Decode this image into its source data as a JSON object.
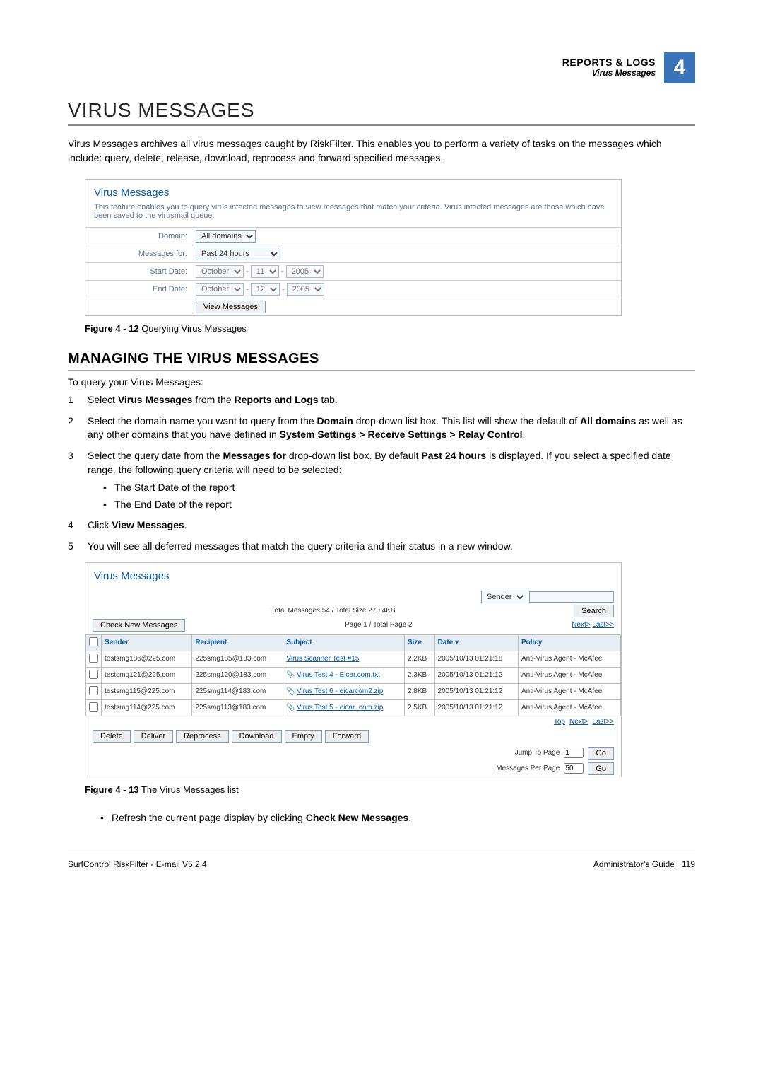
{
  "header": {
    "section": "REPORTS & LOGS",
    "subsection": "Virus Messages",
    "chapter_num": "4"
  },
  "title": "VIRUS MESSAGES",
  "lead": "Virus Messages archives all virus messages caught by RiskFilter. This enables you to perform a variety of tasks on the messages which include: query, delete, release, download, reprocess and forward specified messages.",
  "panel1": {
    "title": "Virus Messages",
    "desc": "This feature enables you to query virus infected messages to view messages that match your criteria. Virus infected messages are those which have been saved to the virusmail queue.",
    "rows": {
      "domain_label": "Domain:",
      "domain_value": "All domains",
      "messagesfor_label": "Messages for:",
      "messagesfor_value": "Past 24 hours",
      "startdate_label": "Start Date:",
      "startdate_month": "October",
      "startdate_day": "11",
      "startdate_year": "2005",
      "enddate_label": "End Date:",
      "enddate_month": "October",
      "enddate_day": "12",
      "enddate_year": "2005",
      "view_btn": "View Messages"
    }
  },
  "figcap1_label": "Figure 4 - 12",
  "figcap1_text": " Querying Virus Messages",
  "sub": "MANAGING THE VIRUS MESSAGES",
  "intro": "To query your Virus Messages:",
  "steps": {
    "s1_a": "Select ",
    "s1_b": "Virus Messages",
    "s1_c": " from the ",
    "s1_d": "Reports and Logs",
    "s1_e": " tab.",
    "s2_a": "Select the domain name you want to query from the ",
    "s2_b": "Domain",
    "s2_c": " drop-down list box. This list will show the default of ",
    "s2_d": "All domains",
    "s2_e": " as well as any other domains that you have defined in ",
    "s2_f": "System Settings > Receive Settings > Relay Control",
    "s2_g": ".",
    "s3_a": "Select the query date from the ",
    "s3_b": "Messages for",
    "s3_c": " drop-down list box. By default ",
    "s3_d": "Past 24 hours",
    "s3_e": " is displayed. If you select a specified date range, the following query criteria will need to be selected:",
    "s3_bul1": "The Start Date of the report",
    "s3_bul2": "The End Date of the report",
    "s4_a": "Click ",
    "s4_b": "View Messages",
    "s4_c": ".",
    "s5": "You will see all deferred messages that match the query criteria and their status in a new window."
  },
  "panel2": {
    "title": "Virus Messages",
    "search_by": "Sender",
    "search_btn": "Search",
    "totals": "Total Messages 54 / Total Size 270.4KB",
    "check_new": "Check New Messages",
    "page_info": "Page 1 / Total Page 2",
    "pager_next": "Next>",
    "pager_last": "Last>>",
    "cols": {
      "sender": "Sender",
      "recipient": "Recipient",
      "subject": "Subject",
      "size": "Size",
      "date": "Date",
      "policy": "Policy"
    },
    "rows": [
      {
        "sender": "testsmg186@225.com",
        "recipient": "225smg185@183.com",
        "subject": "Virus Scanner Test #15",
        "size": "2.2KB",
        "date": "2005/10/13 01:21:18",
        "policy": "Anti-Virus Agent - McAfee",
        "attach": false
      },
      {
        "sender": "testsmg121@225.com",
        "recipient": "225smg120@183.com",
        "subject": "Virus Test 4 - Eicar.com.txt",
        "size": "2.3KB",
        "date": "2005/10/13 01:21:12",
        "policy": "Anti-Virus Agent - McAfee",
        "attach": true
      },
      {
        "sender": "testsmg115@225.com",
        "recipient": "225smg114@183.com",
        "subject": "Virus Test 6 - eicarcom2.zip",
        "size": "2.8KB",
        "date": "2005/10/13 01:21:12",
        "policy": "Anti-Virus Agent - McAfee",
        "attach": true
      },
      {
        "sender": "testsmg114@225.com",
        "recipient": "225smg113@183.com",
        "subject": "Virus Test 5 - eicar_com.zip",
        "size": "2.5KB",
        "date": "2005/10/13 01:21:12",
        "policy": "Anti-Virus Agent - McAfee",
        "attach": true
      }
    ],
    "topnav": {
      "top": "Top",
      "next": "Next>",
      "last": "Last>>"
    },
    "actions": {
      "delete": "Delete",
      "deliver": "Deliver",
      "reprocess": "Reprocess",
      "download": "Download",
      "empty": "Empty",
      "forward": "Forward"
    },
    "jump_label": "Jump To Page",
    "jump_val": "1",
    "perpage_label": "Messages Per Page",
    "perpage_val": "50",
    "go": "Go"
  },
  "figcap2_label": "Figure 4 - 13",
  "figcap2_text": " The Virus Messages list",
  "after_bul_a": "Refresh the current page display by clicking ",
  "after_bul_b": "Check New Messages",
  "after_bul_c": ".",
  "footer": {
    "left": "SurfControl RiskFilter - E-mail V5.2.4",
    "right_a": "Administrator’s Guide",
    "right_b": "119"
  }
}
